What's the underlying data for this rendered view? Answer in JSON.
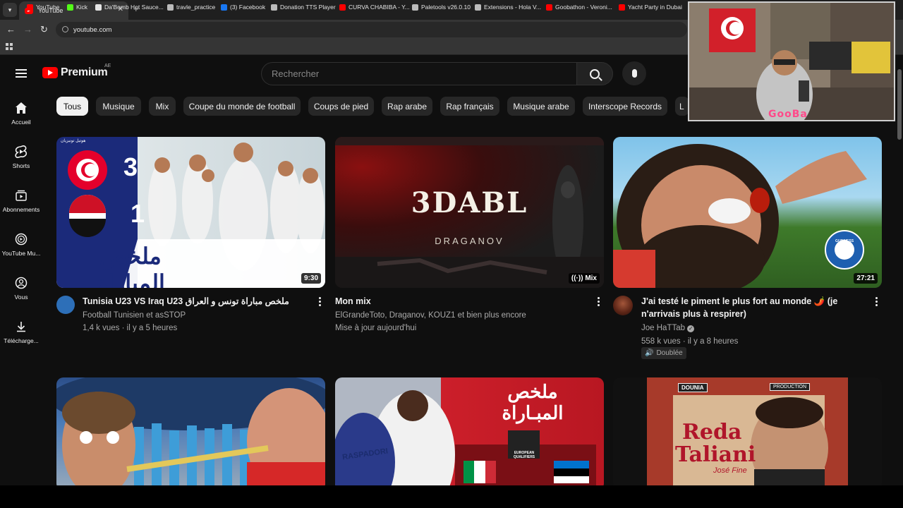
{
  "browser": {
    "tab_title": "YouTube",
    "tab_close": "✕",
    "new_tab": "+",
    "url": "youtube.com",
    "bookmarks": [
      {
        "label": "YouTube",
        "color": "#ff0000"
      },
      {
        "label": "Kick",
        "color": "#53fc18"
      },
      {
        "label": "Da'Bomb Hot Sauce...",
        "color": "#e6e6e6"
      },
      {
        "label": "travle_practice",
        "color": "#bbbbbb"
      },
      {
        "label": "(3) Facebook",
        "color": "#1877f2"
      },
      {
        "label": "Donation TTS Player",
        "color": "#bbbbbb"
      },
      {
        "label": "CURVA CHABIBA - Y...",
        "color": "#ff0000"
      },
      {
        "label": "Paletools v26.0.10",
        "color": "#bbbbbb"
      },
      {
        "label": "Extensions - Hola V...",
        "color": "#bbbbbb"
      },
      {
        "label": "Goobathon - Veroni...",
        "color": "#ff0000"
      },
      {
        "label": "Yacht Party in Dubai",
        "color": "#ff0000"
      }
    ]
  },
  "header": {
    "logo_word": "Premium",
    "country_code": "AE",
    "search_placeholder": "Rechercher"
  },
  "sidebar": [
    {
      "label": "Accueil",
      "icon": "home-icon"
    },
    {
      "label": "Shorts",
      "icon": "shorts-icon"
    },
    {
      "label": "Abonnements",
      "icon": "subscriptions-icon"
    },
    {
      "label": "YouTube Mu...",
      "icon": "youtube-music-icon"
    },
    {
      "label": "Vous",
      "icon": "you-icon"
    },
    {
      "label": "Télécharge...",
      "icon": "download-icon"
    }
  ],
  "chips": [
    "Tous",
    "Musique",
    "Mix",
    "Coupe du monde de football",
    "Coups de pied",
    "Rap arabe",
    "Rap français",
    "Musique arabe",
    "Interscope Records",
    "L"
  ],
  "videos": [
    {
      "title": "Tunisia U23 VS Iraq U23 ملخص مباراة تونس و العراق",
      "channel": "Football Tunisien et asSTOP",
      "stats": "1,4 k vues · il y a 5 heures",
      "duration": "9:30",
      "thumb_score_home": "3",
      "thumb_score_away": "1",
      "thumb_caption": "ملخص المباراة",
      "thumb_badge": "هوتيل تونيزيان"
    },
    {
      "title": "Mon mix",
      "channel": "ElGrandeToto, Draganov, KOUZ1 et bien plus encore",
      "stats": "Mise à jour aujourd'hui",
      "duration": "Mix",
      "thumb_logo": "3DABL",
      "thumb_sub": "DRAGANOV"
    },
    {
      "title": "J'ai testé le piment le plus fort au monde 🌶️ (je n'arrivais plus à respirer)",
      "channel": "Joe HaTTab",
      "stats": "558 k vues · il y a 8 heures",
      "badge": "Doublée",
      "duration": "27:21",
      "thumb_badge": "GUINNESS WORLD RECORDS"
    }
  ],
  "row2": {
    "card2_caption_line1": "ملخص",
    "card2_caption_line2": "المبـاراة",
    "card2_badge": "EUROPEAN QUALIFIERS",
    "card2_jersey": "RASPADORI",
    "card3_label1": "DOUNIA",
    "card3_label2": "PRODUCTION",
    "card3_title1": "Reda",
    "card3_title2": "Taliani",
    "card3_sub": "José Fine"
  },
  "webcam": {
    "overlay_text": "GooBa"
  }
}
